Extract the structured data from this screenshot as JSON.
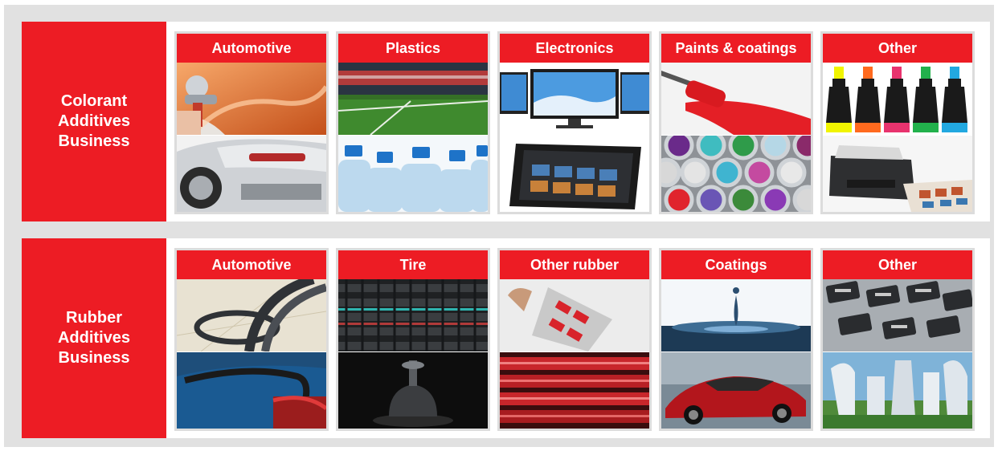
{
  "sections": [
    {
      "label_lines": [
        "Colorant",
        "Additives",
        "Business"
      ],
      "cards": [
        {
          "title": "Automotive",
          "top_icon": "car-spray-paint-image",
          "bottom_icon": "silver-car-rear-image"
        },
        {
          "title": "Plastics",
          "top_icon": "stadium-turf-image",
          "bottom_icon": "water-bottles-image"
        },
        {
          "title": "Electronics",
          "top_icon": "monitors-image",
          "bottom_icon": "tablet-image"
        },
        {
          "title": "Paints & coatings",
          "top_icon": "paint-roller-image",
          "bottom_icon": "paint-cans-image"
        },
        {
          "title": "Other",
          "top_icon": "markers-image",
          "bottom_icon": "printer-image"
        }
      ]
    },
    {
      "label_lines": [
        "Rubber",
        "Additives",
        "Business"
      ],
      "cards": [
        {
          "title": "Automotive",
          "top_icon": "rubber-hoses-image",
          "bottom_icon": "car-seal-image"
        },
        {
          "title": "Tire",
          "top_icon": "tire-tread-image",
          "bottom_icon": "rubber-molding-image"
        },
        {
          "title": "Other rubber",
          "top_icon": "sports-shoe-image",
          "bottom_icon": "rubber-rollers-image"
        },
        {
          "title": "Coatings",
          "top_icon": "water-droplet-image",
          "bottom_icon": "red-sports-car-image"
        },
        {
          "title": "Other",
          "top_icon": "cable-connectors-image",
          "bottom_icon": "building-facade-image"
        }
      ]
    }
  ],
  "colors": {
    "accent_red": "#ed1c24",
    "frame_gray": "#e1e1e1",
    "card_border": "#dcdcdc"
  }
}
